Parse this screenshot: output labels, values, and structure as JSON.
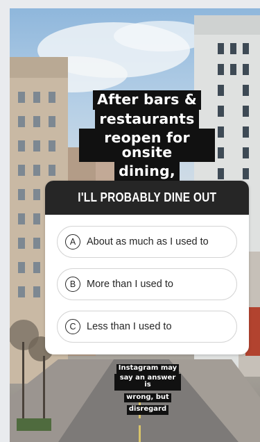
{
  "caption": {
    "lines": [
      "After bars &",
      "restaurants",
      "reopen for onsite",
      "dining,"
    ]
  },
  "poll": {
    "question": "I'LL PROBABLY DINE OUT",
    "options": [
      {
        "letter": "A",
        "text": "About as much as I used to"
      },
      {
        "letter": "B",
        "text": "More than I used to"
      },
      {
        "letter": "C",
        "text": "Less than I used to"
      }
    ]
  },
  "note": {
    "lines": [
      "Instagram may",
      "say an answer is",
      "wrong, but",
      "disregard"
    ]
  }
}
